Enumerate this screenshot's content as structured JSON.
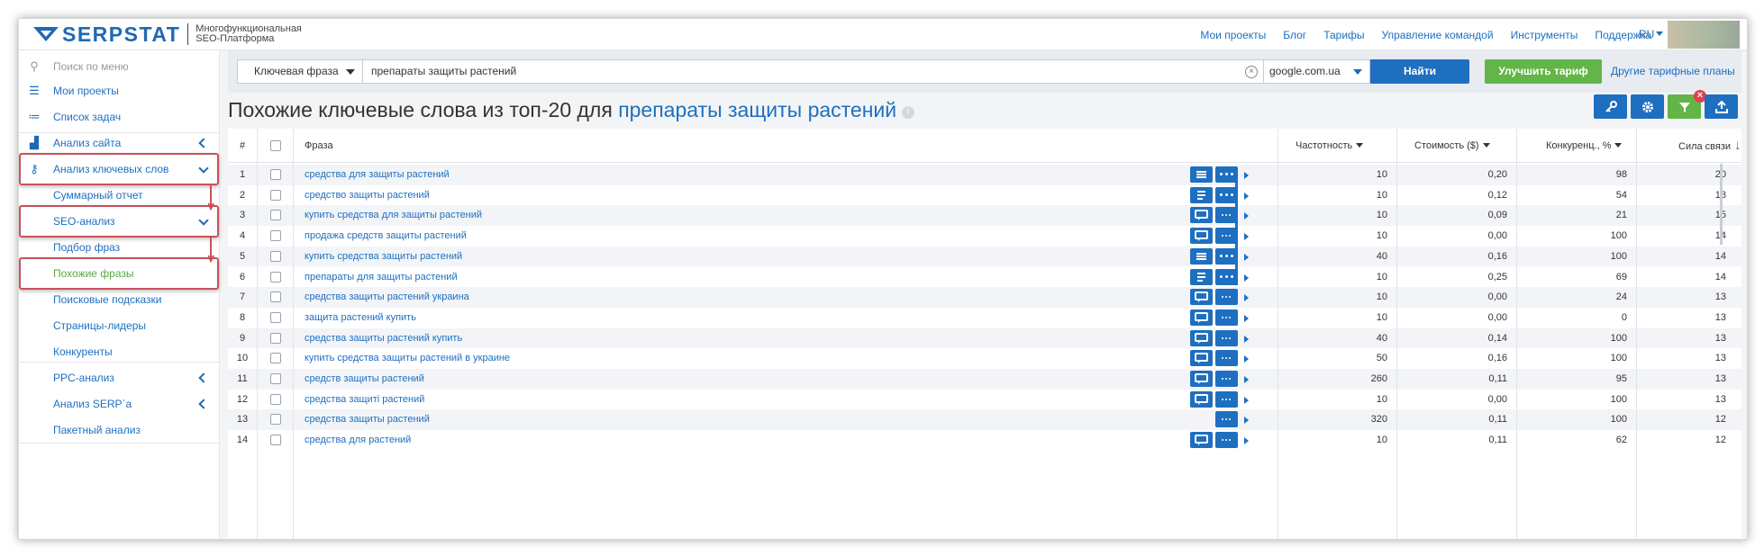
{
  "brand": {
    "name": "SERPSTAT",
    "tagline_1": "Многофункциональная",
    "tagline_2": "SEO-Платформа"
  },
  "topnav": [
    "Мои проекты",
    "Блог",
    "Тарифы",
    "Управление командой",
    "Инструменты",
    "Поддержка"
  ],
  "lang": "RU",
  "sidebar": {
    "search_placeholder": "Поиск по меню",
    "items": {
      "projects": "Мои проекты",
      "tasks": "Список задач",
      "site_analysis": "Анализ сайта",
      "keyword_analysis": "Анализ ключевых слов",
      "summary": "Суммарный отчет",
      "seo_analysis": "SEO-анализ",
      "phrase_selection": "Подбор фраз",
      "similar_phrases": "Похожие фразы",
      "search_suggestions": "Поисковые подсказки",
      "top_pages": "Страницы-лидеры",
      "competitors": "Конкуренты",
      "ppc": "PPC-анализ",
      "serp": "Анализ SERP`a",
      "batch": "Пакетный анализ"
    },
    "active_color": "#5aa844"
  },
  "search": {
    "type_label": "Ключевая фраза",
    "query": "препараты защиты растений",
    "domain": "google.com.ua",
    "find_label": "Найти",
    "upgrade_label": "Улучшить тариф",
    "plans_link": "Другие тарифные планы"
  },
  "page": {
    "title_prefix": "Похожие ключевые слова из топ-20 для",
    "title_query": "препараты защиты растений",
    "info_icon": "i",
    "filter_badge": "×"
  },
  "table": {
    "headers": {
      "num": "#",
      "phrase": "Фраза",
      "freq": "Частотность",
      "cost": "Стоимость ($)",
      "comp": "Конкуренц., %",
      "strength": "Сила связи"
    },
    "rows": [
      {
        "n": "1",
        "phrase": "средства для защиты растений",
        "a": "lines",
        "freq": "10",
        "cost": "0,20",
        "comp": "98",
        "str": "20"
      },
      {
        "n": "2",
        "phrase": "средство защиты растений",
        "a": "doc",
        "freq": "10",
        "cost": "0,12",
        "comp": "54",
        "str": "18"
      },
      {
        "n": "3",
        "phrase": "купить средства для защиты растений",
        "a": "chat",
        "freq": "10",
        "cost": "0,09",
        "comp": "21",
        "str": "15"
      },
      {
        "n": "4",
        "phrase": "продажа средств защиты растений",
        "a": "chat",
        "freq": "10",
        "cost": "0,00",
        "comp": "100",
        "str": "14"
      },
      {
        "n": "5",
        "phrase": "купить средства защиты растений",
        "a": "lines",
        "freq": "40",
        "cost": "0,16",
        "comp": "100",
        "str": "14"
      },
      {
        "n": "6",
        "phrase": "препараты для защиты растений",
        "a": "doc",
        "freq": "10",
        "cost": "0,25",
        "comp": "69",
        "str": "14"
      },
      {
        "n": "7",
        "phrase": "средства защиты растений украина",
        "a": "chat",
        "freq": "10",
        "cost": "0,00",
        "comp": "24",
        "str": "13"
      },
      {
        "n": "8",
        "phrase": "защита растений купить",
        "a": "chat",
        "freq": "10",
        "cost": "0,00",
        "comp": "0",
        "str": "13"
      },
      {
        "n": "9",
        "phrase": "средства защиты растений купить",
        "a": "chat",
        "freq": "40",
        "cost": "0,14",
        "comp": "100",
        "str": "13"
      },
      {
        "n": "10",
        "phrase": "купить средства защиты растений в украине",
        "a": "chat",
        "freq": "50",
        "cost": "0,16",
        "comp": "100",
        "str": "13"
      },
      {
        "n": "11",
        "phrase": "средств защиты растений",
        "a": "chat",
        "freq": "260",
        "cost": "0,11",
        "comp": "95",
        "str": "13"
      },
      {
        "n": "12",
        "phrase": "средства защиті растений",
        "a": "chat",
        "freq": "10",
        "cost": "0,00",
        "comp": "100",
        "str": "13"
      },
      {
        "n": "13",
        "phrase": "средства защиты растений",
        "a": "none",
        "freq": "320",
        "cost": "0,11",
        "comp": "100",
        "str": "12"
      },
      {
        "n": "14",
        "phrase": "средства для растений",
        "a": "chat",
        "freq": "10",
        "cost": "0,11",
        "comp": "62",
        "str": "12"
      }
    ]
  }
}
